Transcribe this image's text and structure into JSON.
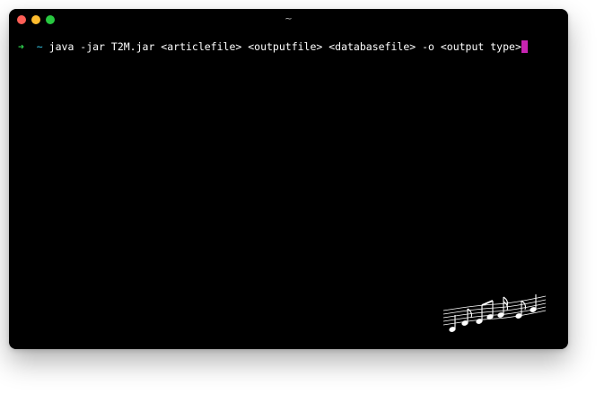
{
  "window": {
    "title": "~",
    "traffic_lights": {
      "close_color": "#fe5f57",
      "minimize_color": "#febc2e",
      "zoom_color": "#28c840"
    }
  },
  "terminal": {
    "prompt_arrow": "➜",
    "prompt_dir": "~",
    "command": "java -jar T2M.jar <articlefile> <outputfile> <databasefile> -o <output type>",
    "cursor_color": "#c724b1",
    "background_color": "#000000"
  },
  "decoration": {
    "icon": "music-notes-staff-icon"
  }
}
